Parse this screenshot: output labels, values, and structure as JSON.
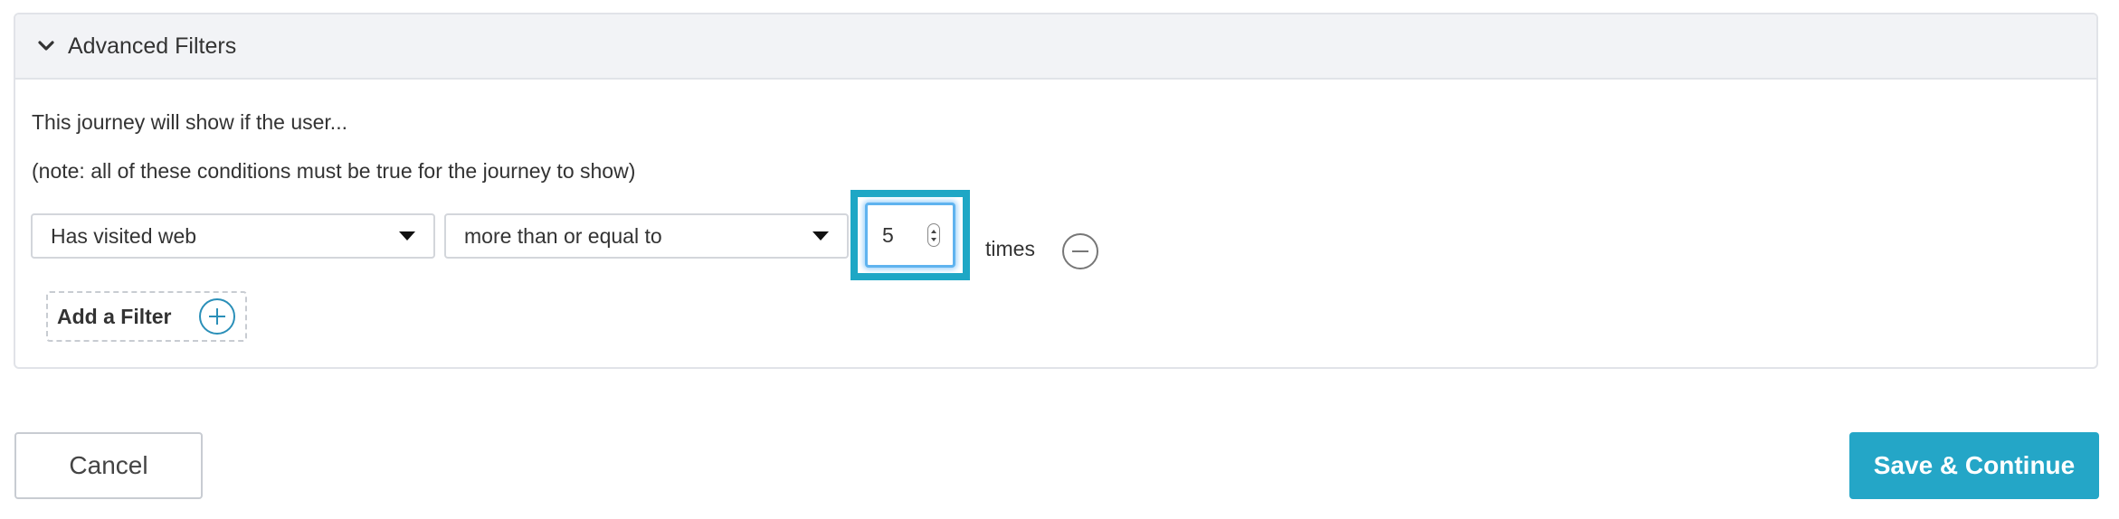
{
  "panel": {
    "title": "Advanced Filters",
    "description": "This journey will show if the user...",
    "note": "(note: all of these conditions must be true for the journey to show)"
  },
  "filter": {
    "condition_value": "Has visited web",
    "operator_value": "more than or equal to",
    "count_value": "5",
    "unit_label": "times"
  },
  "add_filter": {
    "label": "Add a Filter"
  },
  "footer": {
    "cancel_label": "Cancel",
    "save_label": "Save & Continue"
  },
  "colors": {
    "accent": "#24a6c7",
    "highlight": "#1ea7c5",
    "header_bg": "#f2f3f6",
    "border": "#e1e3e8"
  },
  "icons": {
    "collapse": "chevron-down-icon",
    "remove": "minus-circle-icon",
    "add": "plus-circle-icon"
  }
}
